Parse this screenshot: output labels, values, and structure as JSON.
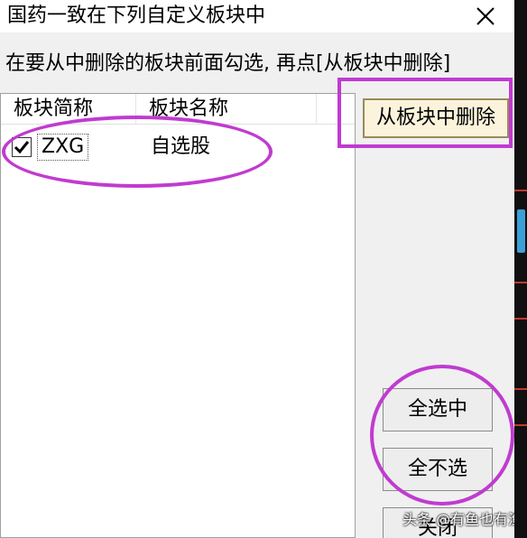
{
  "window": {
    "title": "国药一致在下列自定义板块中",
    "close_icon": "close-icon"
  },
  "instruction": "在要从中删除的板块前面勾选, 再点[从板块中删除]",
  "list": {
    "columns": [
      "板块简称",
      "板块名称",
      ""
    ],
    "rows": [
      {
        "checked": true,
        "code": "ZXG",
        "name": "自选股"
      }
    ]
  },
  "buttons": {
    "remove": "从板块中删除",
    "select_all": "全选中",
    "select_none": "全不选",
    "close": "关闭"
  },
  "watermark": "头条 @有鱼也有渔",
  "colors": {
    "highlight": "#c03bd0",
    "window_bg": "#f0f0f0",
    "list_bg": "#ffffff",
    "primary_button_bg": "#fbf3dc"
  }
}
